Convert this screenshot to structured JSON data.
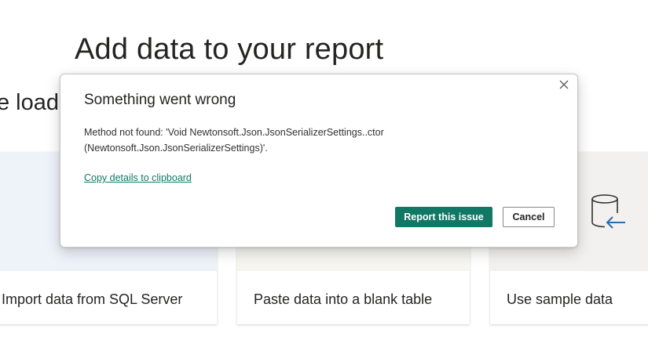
{
  "page": {
    "title": "Add data to your report",
    "subtitle_fragment": "e load"
  },
  "cards": [
    {
      "label": "Import data from SQL Server"
    },
    {
      "label": "Paste data into a blank table"
    },
    {
      "label": "Use sample data",
      "icon": "database-import-icon"
    }
  ],
  "dialog": {
    "title": "Something went wrong",
    "message": "Method not found: 'Void Newtonsoft.Json.JsonSerializerSettings..ctor (Newtonsoft.Json.JsonSerializerSettings)'.",
    "copy_link": "Copy details to clipboard",
    "primary_button": "Report this issue",
    "secondary_button": "Cancel",
    "close_icon": "close-icon"
  },
  "colors": {
    "accent": "#117865",
    "text": "#252423",
    "icon_blue": "#2b6cb0"
  }
}
